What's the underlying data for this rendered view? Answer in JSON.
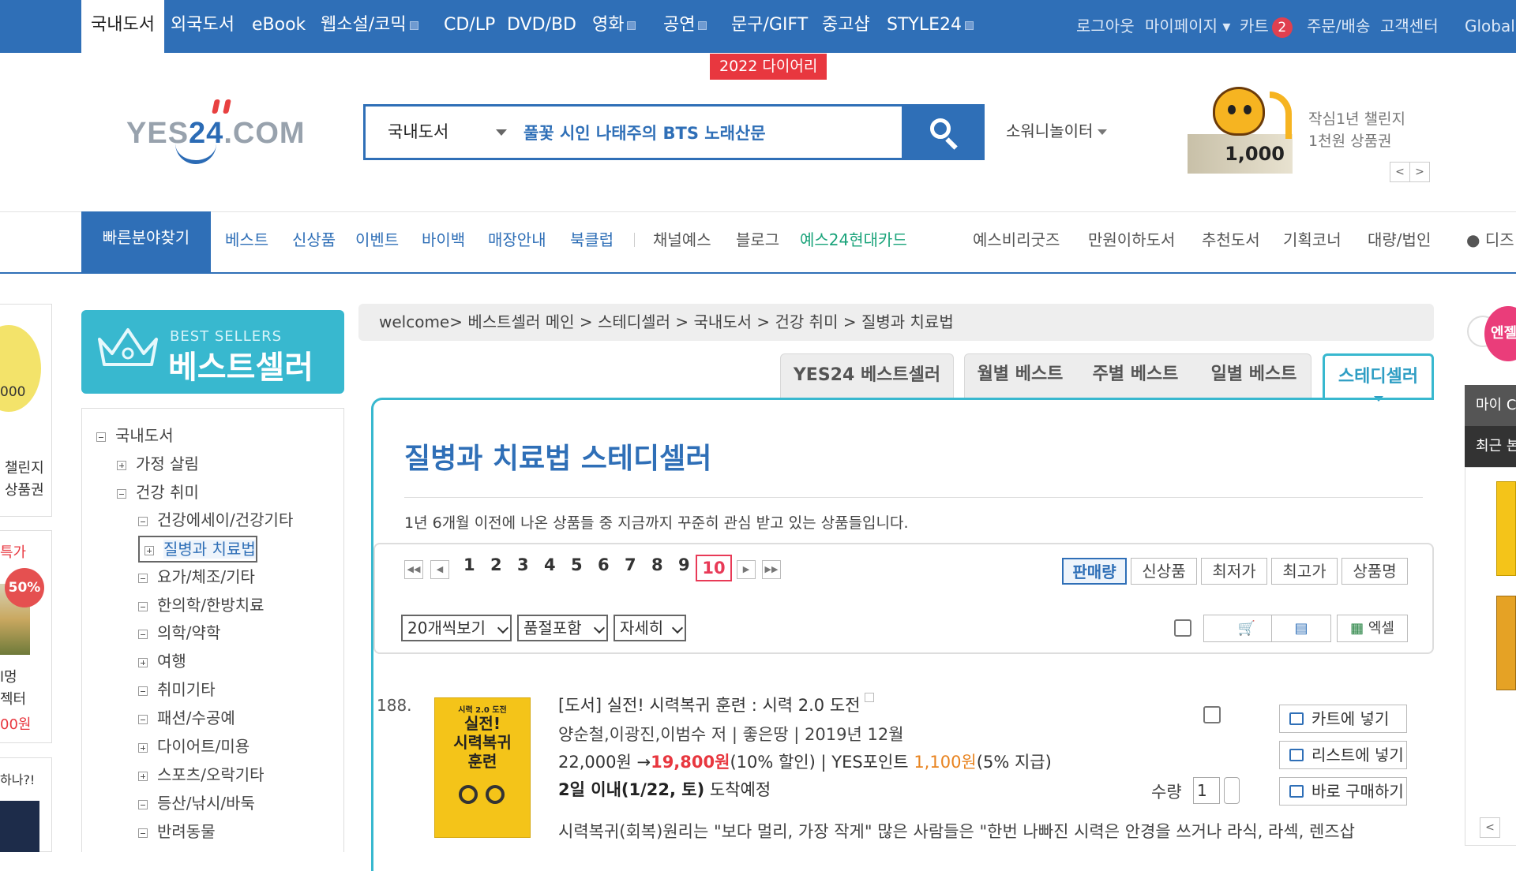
{
  "topnav": {
    "tabs": [
      {
        "label": "국내도서"
      },
      {
        "label": "외국도서"
      },
      {
        "label": "eBook"
      },
      {
        "label": "웹소설/코믹"
      },
      {
        "label": "CD/LP"
      },
      {
        "label": "DVD/BD"
      },
      {
        "label": "영화"
      },
      {
        "label": "공연"
      },
      {
        "label": "문구/GIFT"
      },
      {
        "label": "중고샵"
      },
      {
        "label": "STYLE24"
      }
    ],
    "util": {
      "logout": "로그아웃",
      "mypage": "마이페이지",
      "cart": "카트",
      "cart_count": "2",
      "orders": "주문/배송",
      "support": "고객센터",
      "global": "Global"
    },
    "promo_tag": "2022 다이어리"
  },
  "logo": {
    "text_gray": "YES",
    "text_blue": "24",
    ".com": ".COM",
    "com": ".COM"
  },
  "search": {
    "category": "국내도서",
    "value": "풀꽃 시인 나태주의 BTS 노래산문"
  },
  "social_label": "소워니놀이터",
  "side_promo": {
    "card_value": "1,000",
    "line1": "작심1년 챌린지",
    "line2": "1천원 상품권",
    "prev": "<",
    "next": ">"
  },
  "mainnav": {
    "quick": "빠른분야찾기",
    "left": [
      "베스트",
      "신상품",
      "이벤트",
      "바이백",
      "매장안내",
      "북클럽"
    ],
    "mid": [
      "채널예스",
      "블로그"
    ],
    "card": "예스24현대카드",
    "right": [
      "예스비리굿즈",
      "만원이하도서",
      "추천도서",
      "기획코너",
      "대량/법인"
    ],
    "disney": "디즈"
  },
  "left_float": {
    "t1": "챌린지",
    "t1b": "상품권",
    "red": "특가",
    "badge": "50%",
    "t3a": "l멍",
    "t3b": "젝터",
    "red2": "00원",
    "t4": "하나?!",
    "tiger_val": "000"
  },
  "bestseller_banner": {
    "en": "BEST SELLERS",
    "ko": "베스트셀러"
  },
  "tree": [
    {
      "label": "국내도서",
      "level": 0,
      "sign": "minus"
    },
    {
      "label": "가정 살림",
      "level": 1,
      "sign": "plus"
    },
    {
      "label": "건강 취미",
      "level": 1,
      "sign": "minus"
    },
    {
      "label": "건강에세이/건강기타",
      "level": 2,
      "sign": "minus"
    },
    {
      "label": "질병과 치료법",
      "level": 2,
      "sign": "plus",
      "selected": true
    },
    {
      "label": "요가/체조/기타",
      "level": 2,
      "sign": "minus"
    },
    {
      "label": "한의학/한방치료",
      "level": 2,
      "sign": "minus"
    },
    {
      "label": "의학/약학",
      "level": 2,
      "sign": "minus"
    },
    {
      "label": "여행",
      "level": 2,
      "sign": "plus"
    },
    {
      "label": "취미기타",
      "level": 2,
      "sign": "minus"
    },
    {
      "label": "패션/수공예",
      "level": 2,
      "sign": "minus"
    },
    {
      "label": "다이어트/미용",
      "level": 2,
      "sign": "plus"
    },
    {
      "label": "스포츠/오락기타",
      "level": 2,
      "sign": "plus"
    },
    {
      "label": "등산/낚시/바둑",
      "level": 2,
      "sign": "minus"
    },
    {
      "label": "반려동물",
      "level": 2,
      "sign": "minus"
    }
  ],
  "breadcrumb": "welcome> 베스트셀러 메인 > 스테디셀러 > 국내도서 > 건강 취미 > 질병과 치료법",
  "tabs": [
    "YES24 베스트셀러",
    "월별 베스트",
    "주별 베스트",
    "일별 베스트",
    "스테디셀러"
  ],
  "page_title": "질병과 치료법 스테디셀러",
  "description": "1년 6개월 이전에 나온 상품들 중 지금까지 꾸준히 관심 받고 있는 상품들입니다.",
  "pager": {
    "pages": [
      "1",
      "2",
      "3",
      "4",
      "5",
      "6",
      "7",
      "8",
      "9"
    ],
    "current": "10",
    "first": "◀◀",
    "prev": "◀",
    "next": "▶",
    "last": "▶▶"
  },
  "sort": [
    "판매량",
    "신상품",
    "최저가",
    "최고가",
    "상품명"
  ],
  "selects": {
    "per_page": "20개씩보기",
    "stock": "품절포함",
    "view": "자세히"
  },
  "excel_label": "엑셀",
  "product": {
    "rank": "188.",
    "cover_title": "실전!\n시력복귀\n훈련",
    "cover_top": "시력 2.0 도전",
    "title": "[도서] 실전! 시력복귀 훈련 : 시력 2.0 도전",
    "author": "양순철,이광진,이범수 저 | 좋은땅 | 2019년 12월",
    "price_orig": "22,000원 →",
    "price_sale": "19,800원",
    "discount": "(10% 할인) | YES포인트 ",
    "point": "1,100원",
    "point_rate": "(5% 지급)",
    "delivery_bold": "2일 이내(1/22, 토)",
    "delivery_rest": " 도착예정",
    "desc": "시력복귀(회복)원리는 \"보다 멀리, 가장 작게\" 많은 사람들은 \"한번 나빠진 시력은 안경을 쓰거나 라식, 라섹, 렌즈삽",
    "qty_label": "수량",
    "qty": "1",
    "cart_btn": "카트에 넣기",
    "list_btn": "리스트에 넣기",
    "buy_btn": "바로 구매하기"
  },
  "right_float": {
    "badge": "엔젤",
    "dark1": "마이 C",
    "dark2": "최근 본",
    "arrow": "<"
  },
  "colors": {
    "brand_blue": "#2f6fb7",
    "teal": "#38b8cf",
    "red": "#e8373f"
  }
}
